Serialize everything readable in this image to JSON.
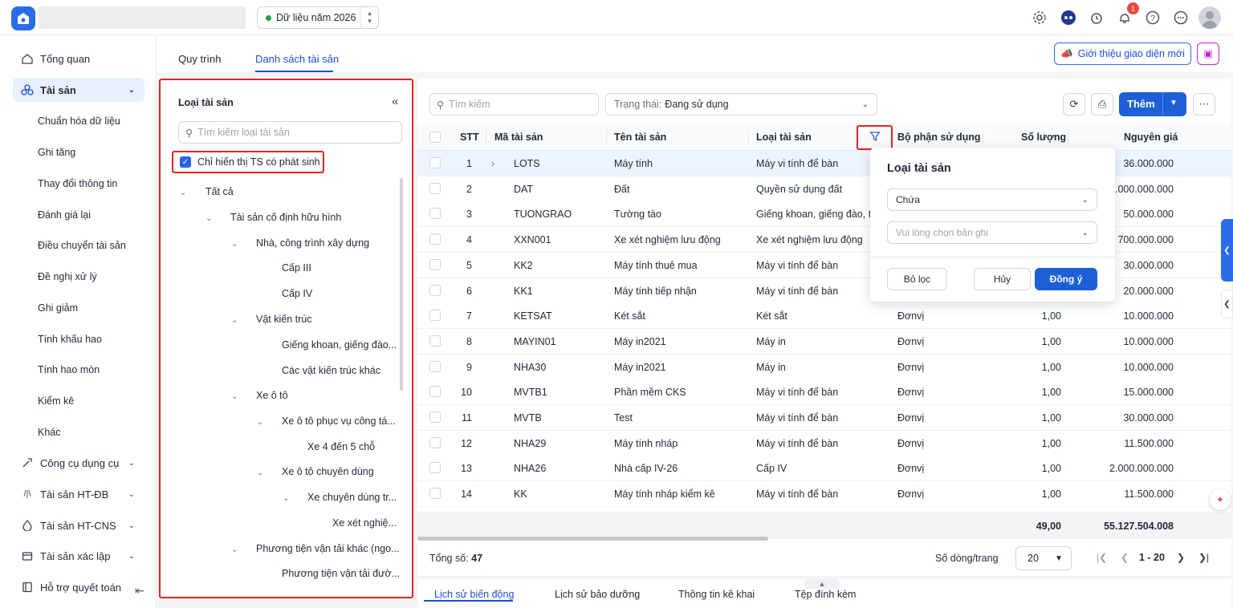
{
  "topbar": {
    "year_label": "Dữ liệu năm 2026",
    "notification_count": "1",
    "icons": [
      "settings-icon",
      "assistant-icon",
      "alarm-icon",
      "bell-icon",
      "help-icon",
      "more-icon",
      "avatar"
    ]
  },
  "sidebar": {
    "items": [
      {
        "label": "Tổng quan",
        "icon": "home-icon"
      },
      {
        "label": "Tài sản",
        "icon": "assets-icon",
        "active": true
      },
      {
        "label": "Công cụ dụng cụ",
        "icon": "tools-icon"
      },
      {
        "label": "Tài sản HT-ĐB",
        "icon": "road-icon"
      },
      {
        "label": "Tài sản HT-CNS",
        "icon": "water-icon"
      },
      {
        "label": "Tài sản xác lập",
        "icon": "box-icon"
      },
      {
        "label": "Hỗ trợ quyết toán",
        "icon": "book-icon"
      }
    ],
    "subitems": [
      "Chuẩn hóa dữ liệu",
      "Ghi tăng",
      "Thay đổi thông tin",
      "Đánh giá lại",
      "Điều chuyển tài sản",
      "Đề nghị xử lý",
      "Ghi giảm",
      "Tính khấu hao",
      "Tính hao mòn",
      "Kiểm kê",
      "Khác"
    ]
  },
  "tabs": {
    "process": "Quy trình",
    "asset_list": "Danh sách tài sản"
  },
  "intro_button": "Giới thiệu giao diện mới",
  "left_panel": {
    "title": "Loại tài sản",
    "search_placeholder": "Tìm kiếm loại tài sản",
    "checkbox_label": "Chỉ hiển thị TS có phát sinh",
    "tree": [
      "Tất cả",
      "Tài sản cố định hữu hình",
      "Nhà, công trình xây dựng",
      "Cấp III",
      "Cấp IV",
      "Vật kiến trúc",
      "Giếng khoan, giếng đào...",
      "Các vật kiến trúc khác",
      "Xe ô tô",
      "Xe ô tô phục vụ công tá...",
      "Xe 4 đến 5 chỗ",
      "Xe ô tô chuyên dùng",
      "Xe chuyên dùng tr...",
      "Xe xét nghiệ...",
      "Phương tiện vận tải khác (ngo...",
      "Phương tiện vận tải đườ..."
    ]
  },
  "toolbar": {
    "search_placeholder": "Tìm kiếm",
    "status_label": "Trạng thái:",
    "status_value": "Đang sử dụng",
    "add_label": "Thêm"
  },
  "table": {
    "headers": {
      "stt": "STT",
      "code": "Mã tài sản",
      "name": "Tên tài sản",
      "type": "Loại tài sản",
      "dept": "Bộ phận sử dụng",
      "qty": "Số lượng",
      "cost": "Nguyên giá"
    },
    "rows": [
      {
        "stt": "1",
        "code": "LOTS",
        "name": "Máy tính",
        "type": "Máy vi tính để bàn",
        "dept": "",
        "qty": "",
        "cost": "36.000.000"
      },
      {
        "stt": "2",
        "code": "DAT",
        "name": "Đất",
        "type": "Quyền sử dụng đất",
        "dept": "",
        "qty": "",
        "cost": ".000.000.000"
      },
      {
        "stt": "3",
        "code": "TUONGRAO",
        "name": "Tường tào",
        "type": "Giếng khoan, giếng đào, tu",
        "dept": "",
        "qty": "",
        "cost": "50.000.000"
      },
      {
        "stt": "4",
        "code": "XXN001",
        "name": "Xe xét nghiệm lưu động",
        "type": "Xe xét nghiệm lưu động",
        "dept": "",
        "qty": "",
        "cost": "700.000.000"
      },
      {
        "stt": "5",
        "code": "KK2",
        "name": "Máy tính thuê mua",
        "type": "Máy vi tính để bàn",
        "dept": "",
        "qty": "",
        "cost": "30.000.000"
      },
      {
        "stt": "6",
        "code": "KK1",
        "name": "Máy tính tiếp nhận",
        "type": "Máy vi tính để bàn",
        "dept": "",
        "qty": "",
        "cost": "20.000.000"
      },
      {
        "stt": "7",
        "code": "KETSAT",
        "name": "Két sắt",
        "type": "Két sắt",
        "dept": "Đơnvị",
        "qty": "1,00",
        "cost": "10.000.000"
      },
      {
        "stt": "8",
        "code": "MAYIN01",
        "name": "Máy in2021",
        "type": "Máy in",
        "dept": "Đơnvị",
        "qty": "1,00",
        "cost": "10.000.000"
      },
      {
        "stt": "9",
        "code": "NHA30",
        "name": "Máy in2021",
        "type": "Máy in",
        "dept": "Đơnvị",
        "qty": "1,00",
        "cost": "10.000.000"
      },
      {
        "stt": "10",
        "code": "MVTB1",
        "name": "Phần mềm CKS",
        "type": "Máy vi tính để bàn",
        "dept": "Đơnvị",
        "qty": "1,00",
        "cost": "15.000.000"
      },
      {
        "stt": "11",
        "code": "MVTB",
        "name": "Test",
        "type": "Máy vi tính để bàn",
        "dept": "Đơnvị",
        "qty": "1,00",
        "cost": "30.000.000"
      },
      {
        "stt": "12",
        "code": "NHA29",
        "name": "Máy tính nháp",
        "type": "Máy vi tính để bàn",
        "dept": "Đơnvị",
        "qty": "1,00",
        "cost": "11.500.000"
      },
      {
        "stt": "13",
        "code": "NHA26",
        "name": "Nhà cấp IV-26",
        "type": "Cấp IV",
        "dept": "Đơnvị",
        "qty": "1,00",
        "cost": "2.000.000.000"
      },
      {
        "stt": "14",
        "code": "KK",
        "name": "Máy tính nháp kiểm kê",
        "type": "Máy vi tính để bàn",
        "dept": "Đơnvị",
        "qty": "1,00",
        "cost": "11.500.000"
      }
    ],
    "total_qty": "49,00",
    "total_cost": "55.127.504.008"
  },
  "footer": {
    "total_label": "Tổng số:",
    "total_value": "47",
    "rows_per_page_label": "Số dòng/trang",
    "rows_per_page": "20",
    "range": "1 - 20"
  },
  "bottom_tabs": [
    "Lịch sử biến động",
    "Lịch sử bảo dưỡng",
    "Thông tin kê khai",
    "Tệp đính kèm"
  ],
  "filter_popup": {
    "title": "Loại tài sản",
    "operator": "Chứa",
    "value_placeholder": "Vui lòng chọn bản ghi",
    "clear_label": "Bỏ lọc",
    "cancel_label": "Hủy",
    "ok_label": "Đồng ý"
  },
  "colors": {
    "primary": "#1d5fd6",
    "highlight_border": "#e02424",
    "active_bg": "#e8efff"
  }
}
